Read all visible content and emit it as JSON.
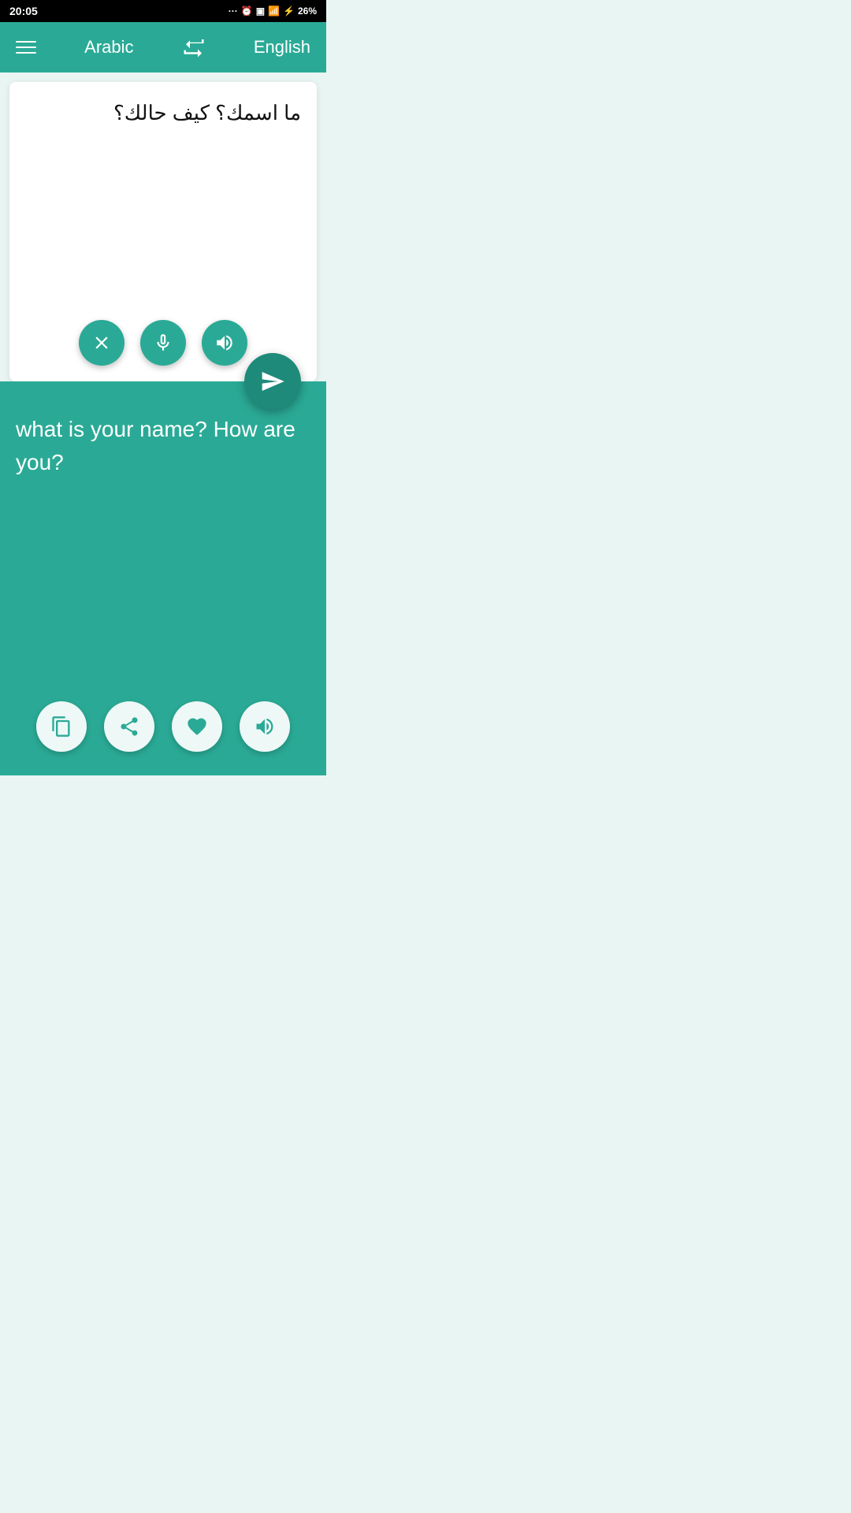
{
  "statusBar": {
    "time": "20:05",
    "battery": "26%",
    "batteryIcon": "🔋"
  },
  "navbar": {
    "menuIcon": "menu-icon",
    "sourceLang": "Arabic",
    "swapIcon": "swap-icon",
    "targetLang": "English"
  },
  "inputSection": {
    "text": "ما اسمك؟ كيف حالك؟",
    "clearLabel": "clear",
    "micLabel": "microphone",
    "speakerLabel": "speaker"
  },
  "translateButton": {
    "label": "translate"
  },
  "outputSection": {
    "text": "what is your name? How are you?",
    "copyLabel": "copy",
    "shareLabel": "share",
    "favoriteLabel": "favorite",
    "speakerLabel": "speaker"
  },
  "colors": {
    "teal": "#2aaa96",
    "darkTeal": "#1d8a7a",
    "white": "#ffffff",
    "black": "#111111"
  }
}
